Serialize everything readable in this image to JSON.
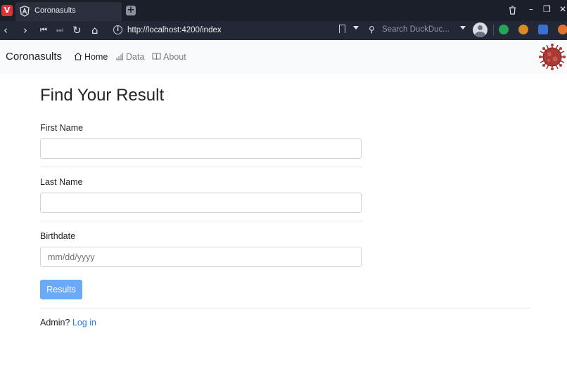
{
  "browser": {
    "tab_title": "Coronasults",
    "url": "http://localhost:4200/index",
    "search_placeholder": "Search DuckDuc..."
  },
  "navbar": {
    "brand": "Coronasults",
    "links": [
      {
        "label": "Home"
      },
      {
        "label": "Data"
      },
      {
        "label": "About"
      }
    ]
  },
  "form": {
    "title": "Find Your Result",
    "first_name_label": "First Name",
    "first_name_value": "",
    "last_name_label": "Last Name",
    "last_name_value": "",
    "birthdate_label": "Birthdate",
    "birthdate_placeholder": "mm/dd/yyyy",
    "submit_label": "Results"
  },
  "footer": {
    "admin_text": "Admin?",
    "login_label": "Log in"
  },
  "colors": {
    "primary": "#6aa9f6",
    "link": "#2a7be4",
    "browser_chrome": "#1b1f2a"
  }
}
